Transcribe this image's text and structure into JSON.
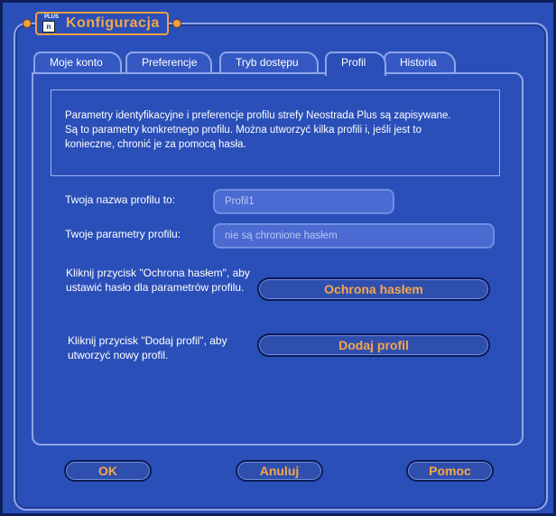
{
  "window": {
    "title": "Konfiguracja",
    "logo_small": "PLUS",
    "logo_letter": "n"
  },
  "tabs": [
    {
      "label": "Moje konto",
      "active": false
    },
    {
      "label": "Preferencje",
      "active": false
    },
    {
      "label": "Tryb dostępu",
      "active": false
    },
    {
      "label": "Profil",
      "active": true
    },
    {
      "label": "Historia",
      "active": false
    }
  ],
  "info": {
    "line1": "Parametry identyfikacyjne i preferencje profilu strefy Neostrada Plus są zapisywane.",
    "line2": "Są to parametry konkretnego profilu. Można utworzyć kilka profili i, jeśli jest to",
    "line3": "konieczne, chronić je za pomocą hasła."
  },
  "profile": {
    "name_label": "Twoja nazwa profilu to:",
    "name_value": "Profil1",
    "params_label": "Twoje parametry profilu:",
    "params_value": "nie są chronione hasłem"
  },
  "password": {
    "hint_line1": "Kliknij przycisk \"Ochrona hasłem\", aby",
    "hint_line2": "ustawić hasło dla parametrów profilu.",
    "button_label": "Ochrona hasłem"
  },
  "add_profile": {
    "hint_line1": "Kliknij przycisk \"Dodaj profil\", aby",
    "hint_line2": "utworzyć nowy profil.",
    "button_label": "Dodaj profil"
  },
  "footer": {
    "ok_label": "OK",
    "cancel_label": "Anuluj",
    "help_label": "Pomoc"
  },
  "colors": {
    "accent": "#f5a64a",
    "panel": "#2a4fb8",
    "border": "#8fa6e8"
  }
}
